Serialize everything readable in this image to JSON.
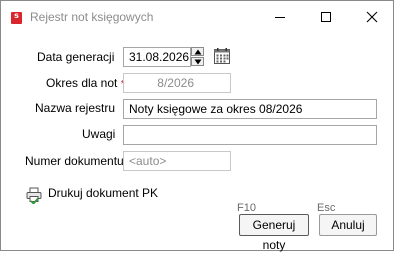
{
  "window": {
    "title": "Rejestr not księgowych",
    "app_icon_letter": "s",
    "app_icon_color": "#d9262c"
  },
  "form": {
    "date_label": "Data generacji",
    "date_value": "31.08.2026",
    "period_label": "Okres dla not",
    "period_required_marker": "*",
    "period_value": "8/2026",
    "name_label": "Nazwa rejestru",
    "name_value": "Noty księgowe za okres 08/2026",
    "remarks_label": "Uwagi",
    "remarks_value": "",
    "docnum_label": "Numer dokumentu",
    "docnum_placeholder": "<auto>"
  },
  "print": {
    "label": "Drukuj dokument PK",
    "icon": "printer-check-icon"
  },
  "actions": {
    "generate_key": "F10",
    "generate_label": "Generuj noty",
    "cancel_key": "Esc",
    "cancel_label": "Anuluj"
  },
  "colors": {
    "required": "#d0203a",
    "disabled_text": "#8c8c8c"
  }
}
